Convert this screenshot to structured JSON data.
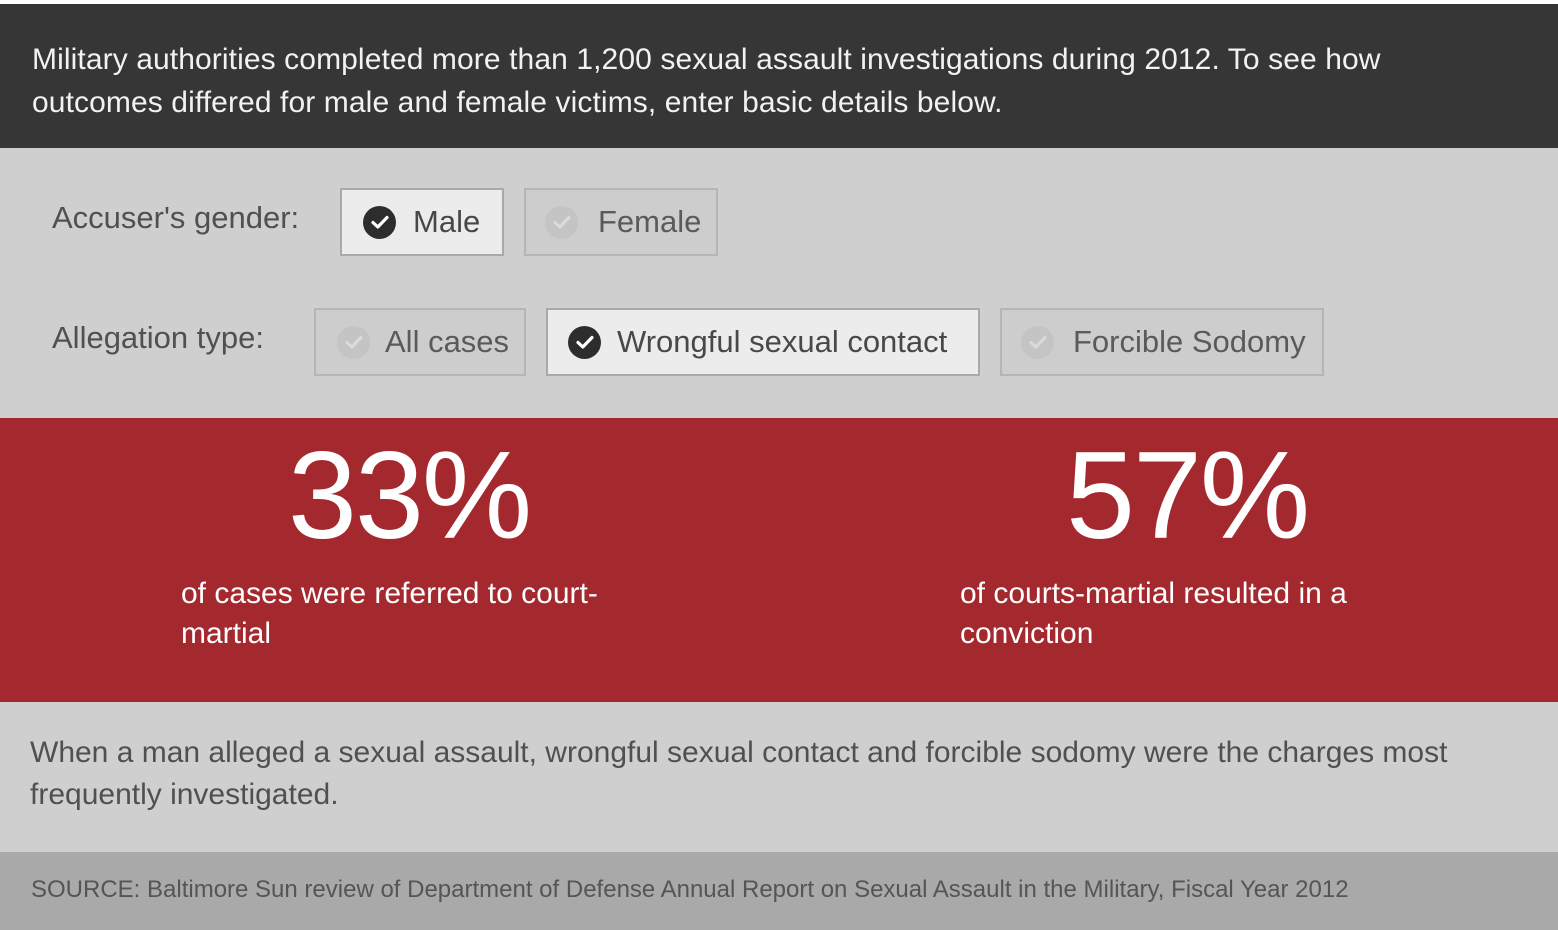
{
  "intro": {
    "text": "Military authorities completed more than 1,200 sexual assault investigations during 2012. To see how outcomes differed for male and female victims, enter basic details below."
  },
  "filters": {
    "gender": {
      "label": "Accuser's gender:",
      "options": [
        {
          "label": "Male",
          "selected": true
        },
        {
          "label": "Female",
          "selected": false
        }
      ]
    },
    "allegation": {
      "label": "Allegation type:",
      "options": [
        {
          "label": "All cases",
          "selected": false
        },
        {
          "label": "Wrongful sexual contact",
          "selected": true
        },
        {
          "label": "Forcible Sodomy",
          "selected": false
        }
      ]
    }
  },
  "stats": [
    {
      "value": "33%",
      "description": "of cases were referred to court-martial"
    },
    {
      "value": "57%",
      "description": "of courts-martial resulted in a conviction"
    }
  ],
  "summary": {
    "text": "When a man alleged a sexual assault, wrongful sexual contact and forcible sodomy were the charges most frequently investigated."
  },
  "source": {
    "text": "SOURCE: Baltimore Sun review of Department of Defense Annual Report on Sexual Assault in the Military, Fiscal Year 2012"
  },
  "colors": {
    "header_bg": "#363636",
    "panel_bg": "#cfcfcf",
    "accent_red": "#a3292f",
    "footer_bg": "#a9a9a9",
    "check_selected": "#2d2d2d",
    "check_unselected": "#c4c4c4"
  },
  "icons": {
    "option_check": "check-circle-icon"
  }
}
